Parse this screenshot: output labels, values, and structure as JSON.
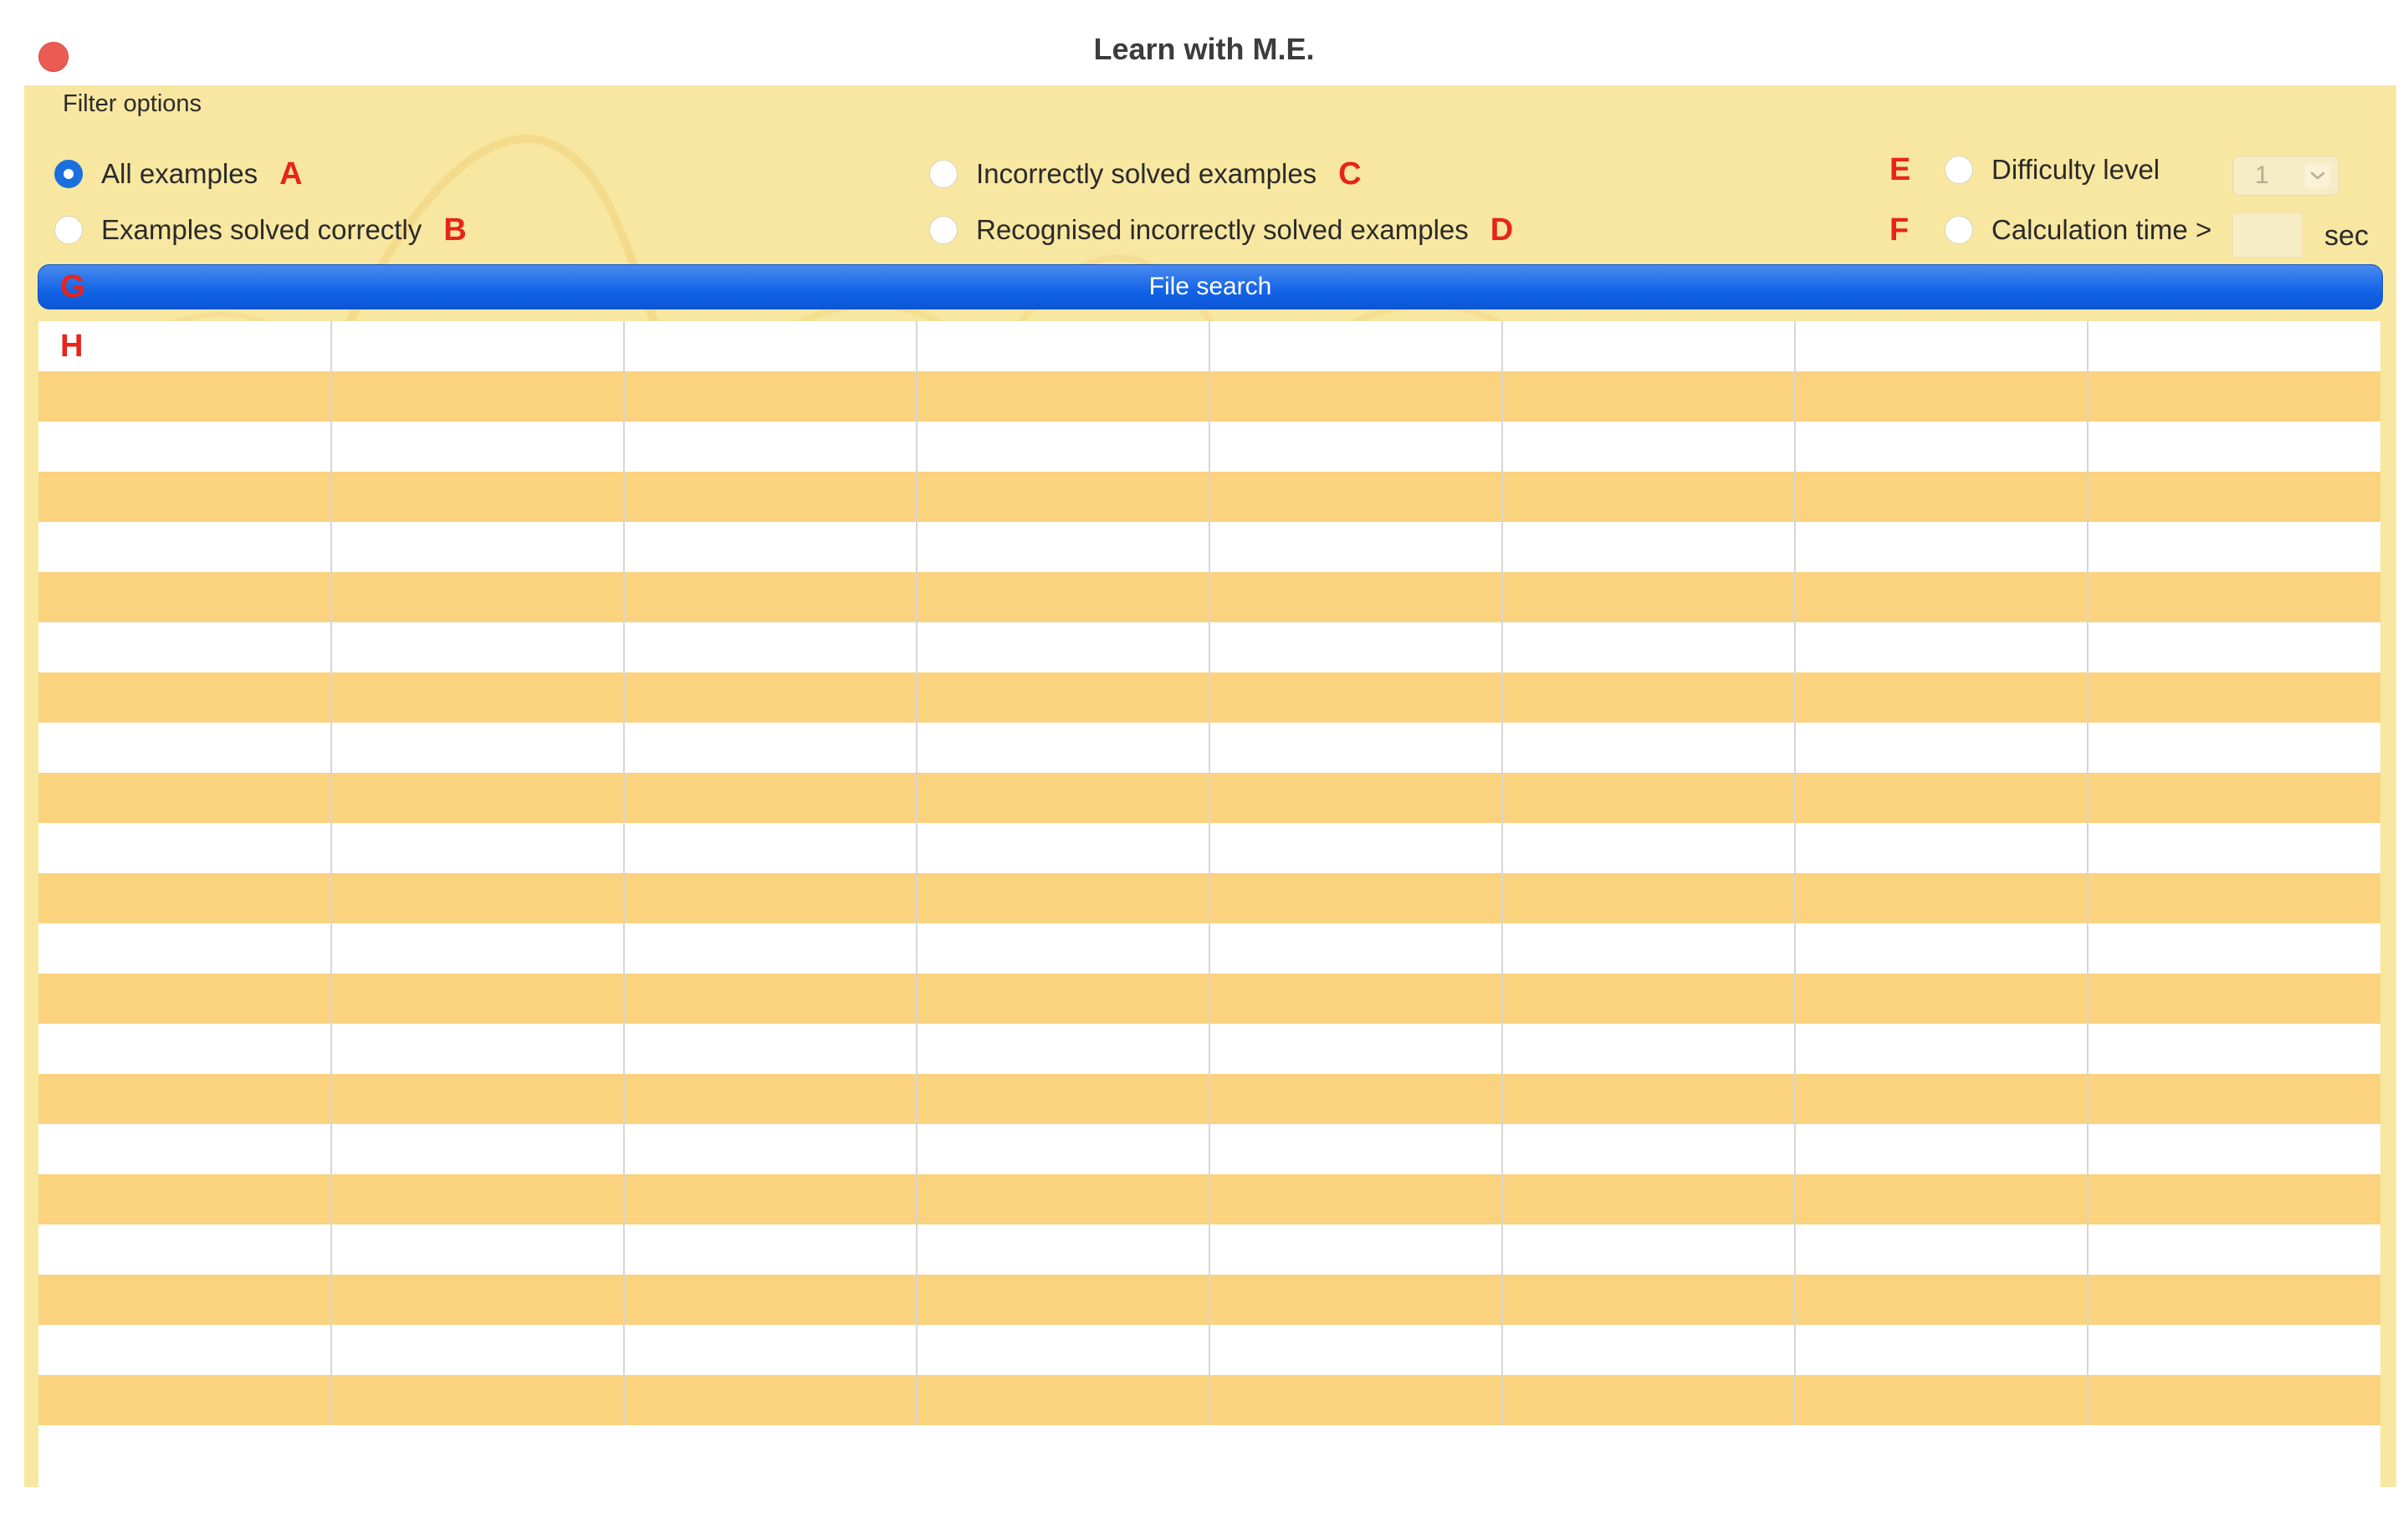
{
  "window": {
    "title": "Learn with M.E."
  },
  "filter": {
    "group_label": "Filter options",
    "options": [
      {
        "label": "All examples",
        "marker": "A",
        "selected": true
      },
      {
        "label": "Examples solved correctly",
        "marker": "B",
        "selected": false
      },
      {
        "label": "Incorrectly solved examples",
        "marker": "C",
        "selected": false
      },
      {
        "label": "Recognised incorrectly solved examples",
        "marker": "D",
        "selected": false
      }
    ],
    "difficulty": {
      "marker": "E",
      "label": "Difficulty level",
      "selected": false,
      "value": "1"
    },
    "calc_time": {
      "marker": "F",
      "label": "Calculation time >",
      "selected": false,
      "value": "",
      "unit": "sec"
    }
  },
  "search": {
    "marker": "G",
    "label": "File search"
  },
  "table": {
    "marker": "H",
    "columns": 8,
    "rows": 22
  },
  "colors": {
    "panel": "#f8e7a0",
    "row_alt": "#fbd27e",
    "accent": "#1363e6",
    "marker": "#e8241a",
    "close": "#ec5b52"
  },
  "icons": {
    "close": "close-dot-icon",
    "select": "chevron-down-icon"
  }
}
